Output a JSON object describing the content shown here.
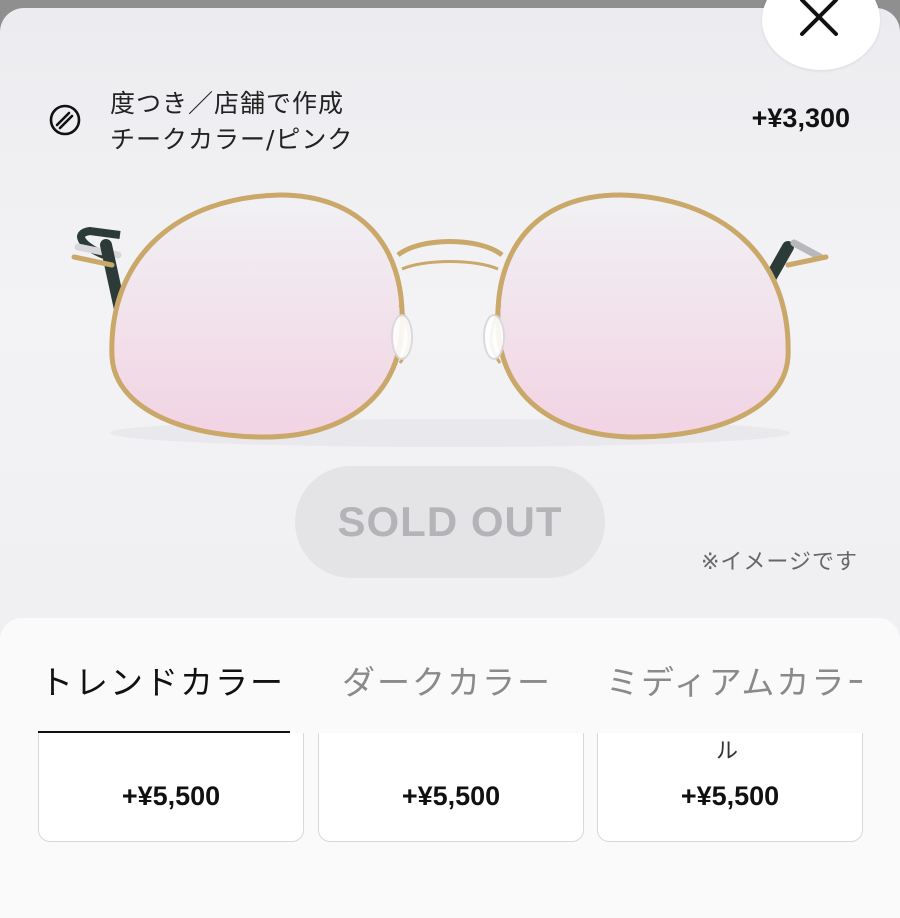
{
  "lens_option": {
    "icon": "lens-icon",
    "line1": "度つき／店舗で作成",
    "line2": "チークカラー/ピンク",
    "price": "+¥3,300"
  },
  "sold_out_label": "SOLD OUT",
  "image_note": "※イメージです",
  "tabs": [
    {
      "label": "トレンドカラー",
      "active": true
    },
    {
      "label": "ダークカラー",
      "active": false
    },
    {
      "label": "ミディアムカラー",
      "active": false
    }
  ],
  "cards": [
    {
      "price": "+¥5,500",
      "overflow": ""
    },
    {
      "price": "+¥5,500",
      "overflow": ""
    },
    {
      "price": "+¥5,500",
      "overflow": "ル"
    }
  ],
  "colors": {
    "lens_tint": "#f2d3e3",
    "frame_gold": "#c9a86a",
    "temple_dark": "#2d3b38"
  }
}
